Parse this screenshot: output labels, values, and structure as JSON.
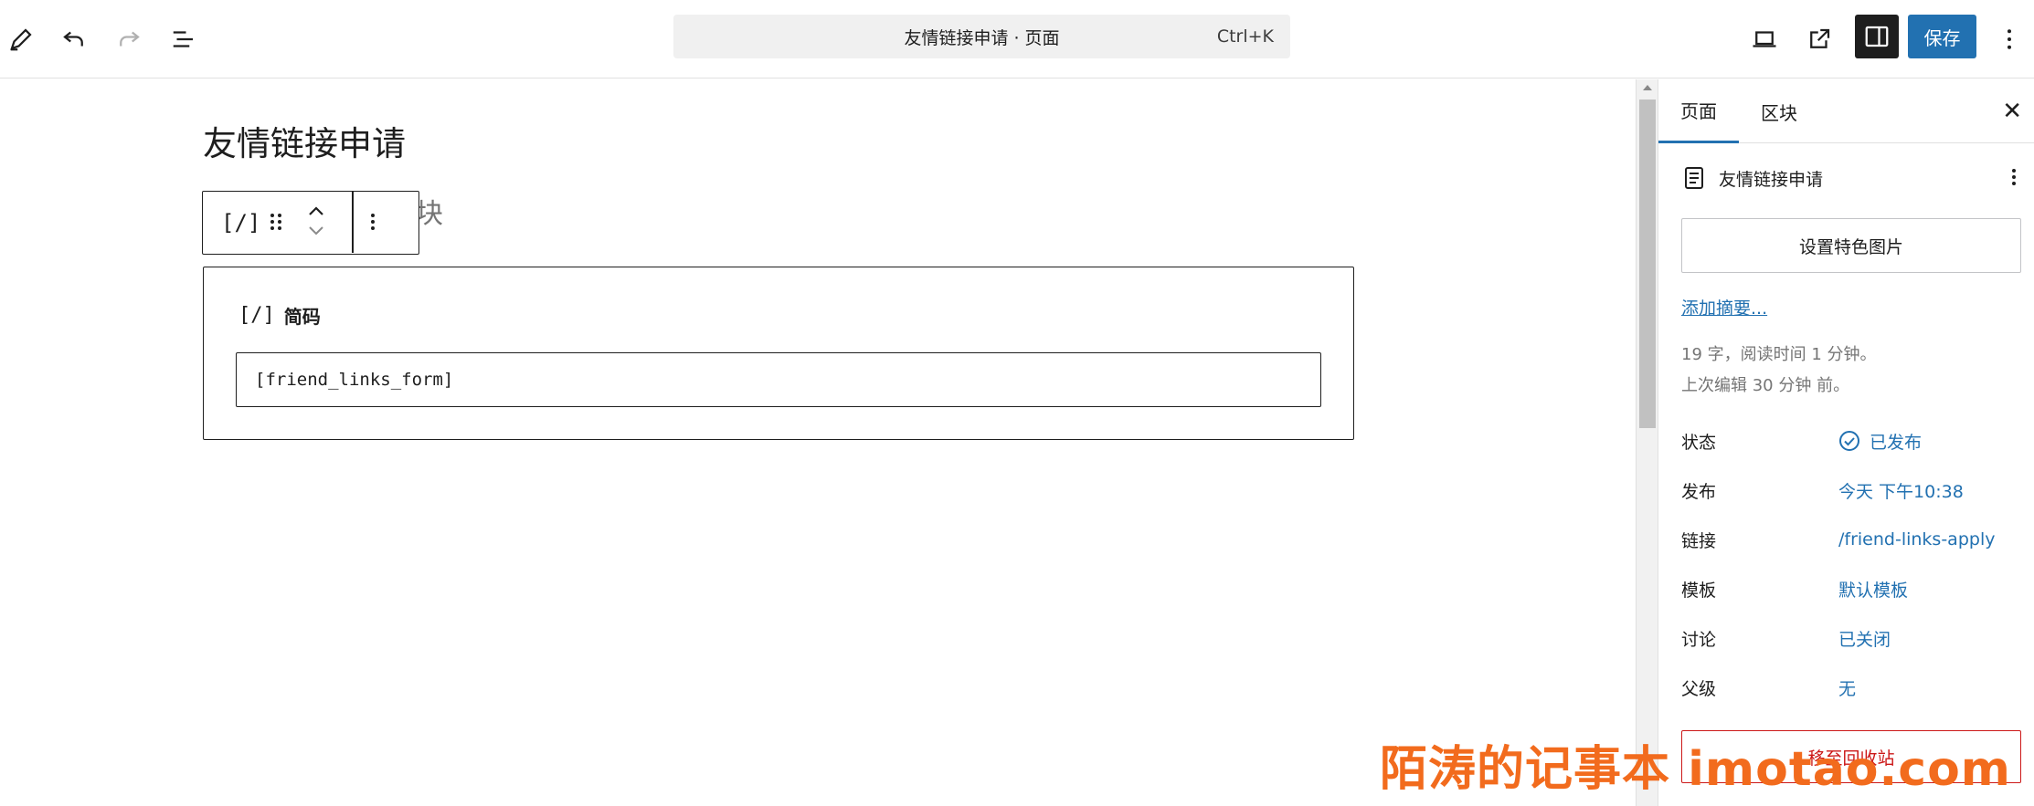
{
  "header": {
    "command_title": "友情链接申请 · 页面",
    "command_shortcut": "Ctrl+K",
    "save_label": "保存"
  },
  "editor": {
    "post_title": "友情链接申请",
    "ghost_hint": "块",
    "toolbar_shortcode_icon": "[/]",
    "block": {
      "label_icon": "[/]",
      "label": "简码",
      "value": "[friend_links_form]"
    }
  },
  "sidebar": {
    "tabs": [
      {
        "label": "页面",
        "active": true
      },
      {
        "label": "区块",
        "active": false
      }
    ],
    "close_icon": "close-icon",
    "doc_title": "友情链接申请",
    "featured_image_button": "设置特色图片",
    "add_excerpt": "添加摘要...",
    "stats": "19 字，阅读时间 1 分钟。",
    "last_edited": "上次编辑 30 分钟 前。",
    "rows": [
      {
        "key": "状态",
        "value": "已发布"
      },
      {
        "key": "发布",
        "value": "今天 下午10:38"
      },
      {
        "key": "链接",
        "value": "/friend-links-apply"
      },
      {
        "key": "模板",
        "value": "默认模板"
      },
      {
        "key": "讨论",
        "value": "已关闭"
      },
      {
        "key": "父级",
        "value": "无"
      }
    ],
    "trash_button": "移至回收站"
  },
  "watermark": "陌涛的记事本 imotao.com",
  "colors": {
    "accent": "#2271b1",
    "danger": "#cc1818",
    "watermark": "#f26b1d"
  }
}
